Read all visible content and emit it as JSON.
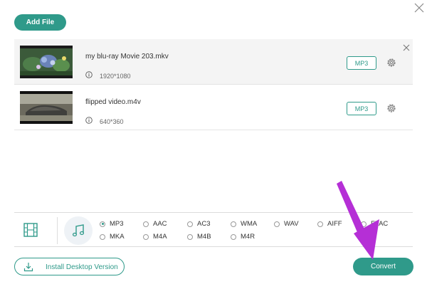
{
  "toolbar": {
    "add_file_label": "Add File"
  },
  "files": [
    {
      "name": "my blu-ray Movie 203.mkv",
      "resolution": "1920*1080",
      "format": "MP3"
    },
    {
      "name": "flipped video.m4v",
      "resolution": "640*360",
      "format": "MP3"
    }
  ],
  "formats": {
    "selected": "MP3",
    "row1": [
      "MP3",
      "AAC",
      "AC3",
      "WMA",
      "WAV",
      "AIFF",
      "FLAC"
    ],
    "row2": [
      "MKA",
      "M4A",
      "M4B",
      "M4R"
    ]
  },
  "footer": {
    "install_label": "Install Desktop Version",
    "convert_label": "Convert"
  },
  "colors": {
    "accent": "#2f9a8a",
    "annotation_arrow": "#b52fd6"
  },
  "icons": [
    "close-icon",
    "info-icon",
    "gear-icon",
    "film-icon",
    "music-note-icon",
    "download-icon"
  ]
}
